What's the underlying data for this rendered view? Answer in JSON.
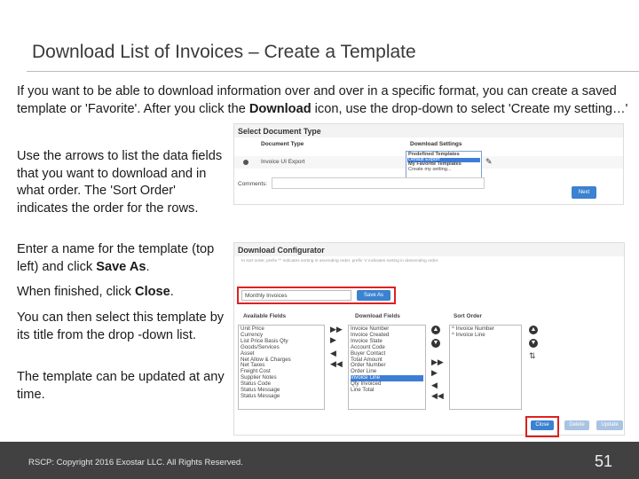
{
  "slide": {
    "title": "Download List of Invoices – Create a Template",
    "intro_before": "If you want to be able to download information over and over in a specific format, you can create a saved template or 'Favorite'.  After you click the ",
    "intro_bold": "Download",
    "intro_after": " icon, use the drop-down to select 'Create my setting…'",
    "para_arrows": "Use the arrows to list the data fields that you want to download and in what order.  The 'Sort Order' indicates the order for the rows.",
    "para_name_before": "Enter a name for the template (top left) and click ",
    "para_name_bold": "Save As",
    "para_name_after": ".",
    "para_finish_before": "When finished, click ",
    "para_finish_bold": "Close",
    "para_finish_after": ".",
    "para_select": "You can then select this template by its title from the drop -down list.",
    "para_update": "The template can be updated at any time.",
    "footer_copy": "RSCP: Copyright 2016 Exostar LLC. All Rights Reserved.",
    "page_number": "51"
  },
  "select_document_type": {
    "header": "Select Document Type",
    "col_document_type": "Document Type",
    "col_download_settings": "Download Settings",
    "document_type_value": "Invoice UI Export",
    "comments_label": "Comments:",
    "next_label": "Next",
    "dropdown_items": [
      {
        "label": "Predefined Templates",
        "kind": "group"
      },
      {
        "label": "Default Export",
        "kind": "selected"
      },
      {
        "label": "My Favorite Templates",
        "kind": "group"
      },
      {
        "label": "Create my setting...",
        "kind": "item"
      }
    ]
  },
  "download_configurator": {
    "header": "Download Configurator",
    "hint": "In sort order, prefix '^' indicates sorting in ascending order, prefix 'v' indicates sorting in descending order.",
    "template_name_value": "Monthly Invoices",
    "save_as_label": "Save As",
    "available_fields_label": "Available Fields",
    "download_fields_label": "Download Fields",
    "sort_order_label": "Sort Order",
    "available_fields": [
      "Unit Price",
      "Currency",
      "List Price Basis Qty",
      "Goods/Services",
      "Asset",
      "Net Allow & Charges",
      "Net Taxes",
      "Freight Cost",
      "Supplier Notes",
      "Status Code",
      "Status Message",
      "Status Message"
    ],
    "download_fields": [
      "Invoice Number",
      "Invoice Created",
      "Invoice State",
      "Account Code",
      "Buyer Contact",
      "Total Amount",
      "Order Number",
      "Order Line",
      "Invoice Line",
      "Qty Invoiced",
      "Line Total"
    ],
    "download_selected_index": 8,
    "sort_order": [
      "^ Invoice Number",
      "^ Invoice Line"
    ],
    "close_label": "Close",
    "delete_label": "Delete",
    "update_label": "Update"
  }
}
